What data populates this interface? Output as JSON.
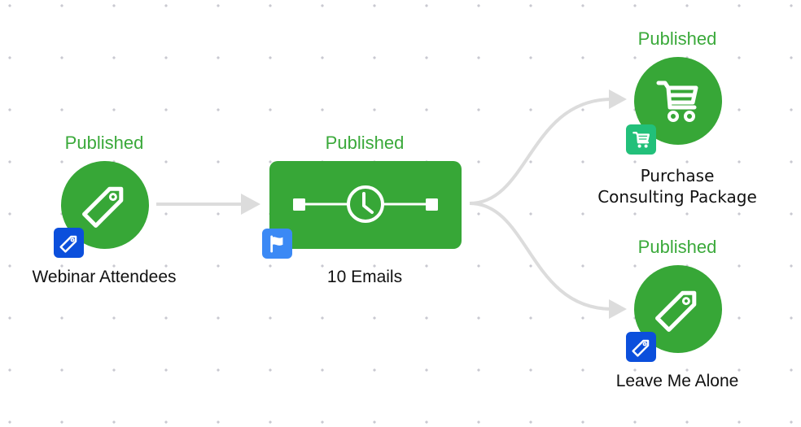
{
  "colors": {
    "node_green": "#37a737",
    "status_green": "#3aa93a",
    "tag_badge_blue": "#0b4fdc",
    "flag_badge_blue": "#3b89f5",
    "cart_badge_green": "#22c07a",
    "edge_gray": "#dcdcdc"
  },
  "nodes": [
    {
      "id": "webinar-attendees",
      "type": "tag",
      "status": "Published",
      "label": "Webinar Attendees",
      "icon": "tag-icon",
      "badge_icon": "tag-icon"
    },
    {
      "id": "emails",
      "type": "email-sequence",
      "status": "Published",
      "label": "10 Emails",
      "icon": "timer-sequence-icon",
      "badge_icon": "flag-icon"
    },
    {
      "id": "purchase-consulting-package",
      "type": "purchase",
      "status": "Published",
      "label_lines": [
        "Purchase",
        "Consulting Package"
      ],
      "icon": "cart-icon",
      "badge_icon": "cart-icon"
    },
    {
      "id": "leave-me-alone",
      "type": "tag",
      "status": "Published",
      "label": "Leave Me Alone",
      "icon": "tag-icon",
      "badge_icon": "tag-icon"
    }
  ],
  "edges": [
    {
      "from": "webinar-attendees",
      "to": "emails"
    },
    {
      "from": "emails",
      "to": "purchase-consulting-package"
    },
    {
      "from": "emails",
      "to": "leave-me-alone"
    }
  ]
}
